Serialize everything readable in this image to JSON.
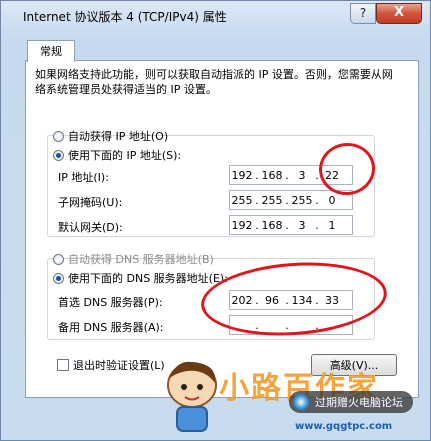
{
  "window": {
    "title": "Internet 协议版本 4 (TCP/IPv4) 属性",
    "help_glyph": "?",
    "close_glyph": "X"
  },
  "tabs": [
    {
      "label": "常规"
    }
  ],
  "description": "如果网络支持此功能，则可以获取自动指派的 IP 设置。否则，您需要从网络系统管理员处获得适当的 IP 设置。",
  "ip_section": {
    "auto_label": "自动获得 IP 地址(O)",
    "manual_label": "使用下面的 IP 地址(S):",
    "selected": "manual",
    "fields": [
      {
        "label": "IP 地址(I):",
        "octets": [
          "192",
          "168",
          "3",
          "22"
        ]
      },
      {
        "label": "子网掩码(U):",
        "octets": [
          "255",
          "255",
          "255",
          "0"
        ]
      },
      {
        "label": "默认网关(D):",
        "octets": [
          "192",
          "168",
          "3",
          "1"
        ]
      }
    ]
  },
  "dns_section": {
    "auto_label": "自动获得 DNS 服务器地址(B)",
    "manual_label": "使用下面的 DNS 服务器地址(E):",
    "selected": "manual",
    "fields": [
      {
        "label": "首选 DNS 服务器(P):",
        "octets": [
          "202",
          "96",
          "134",
          "33"
        ]
      },
      {
        "label": "备用 DNS 服务器(A):",
        "octets": [
          "",
          "",
          "",
          ""
        ]
      }
    ]
  },
  "validate_checkbox": {
    "label": "退出时验证设置(L)",
    "checked": false
  },
  "advanced_button": {
    "label": "高级(V)..."
  },
  "watermark": {
    "brand": "小路百作家",
    "badge": "过期赠火电脑论坛",
    "url": "www.gqgtpc.com"
  }
}
